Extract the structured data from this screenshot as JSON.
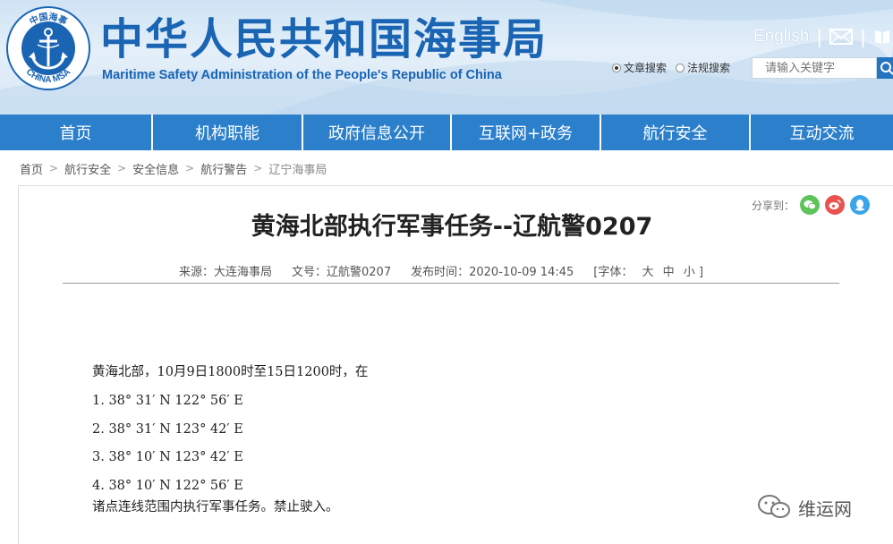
{
  "header": {
    "logo_top_text": "中国海事",
    "logo_bottom_text": "CHINA MSA",
    "title_cn": "中华人民共和国海事局",
    "title_en": "Maritime Safety Administration of the People's Republic of China",
    "english_link": "English",
    "separator": "|",
    "search_options": [
      "文章搜索",
      "法规搜索"
    ],
    "search_placeholder": "请输入关键字"
  },
  "nav": {
    "items": [
      "首页",
      "机构职能",
      "政府信息公开",
      "互联网+政务",
      "航行安全",
      "互动交流"
    ]
  },
  "breadcrumb": {
    "items": [
      "首页",
      "航行安全",
      "安全信息",
      "航行警告",
      "辽宁海事局"
    ],
    "separator": ">"
  },
  "share": {
    "label": "分享到："
  },
  "article": {
    "title": "黄海北部执行军事任务--辽航警0207",
    "source": "来源：大连海事局",
    "doc_no": "文号：辽航警0207",
    "publish_time": "发布时间：2020-10-09 14:45",
    "font_label": "[字体：",
    "font_sizes": [
      "大",
      "中",
      "小"
    ],
    "font_close": "]",
    "intro": "黄海北部，10月9日1800时至15日1200时，在",
    "coords": [
      "1. 38° 31′ N  122° 56′ E",
      "2. 38° 31′ N  123° 42′ E",
      "3. 38° 10′ N  123° 42′ E",
      "4. 38° 10′ N  122° 56′ E"
    ],
    "closing": "诸点连线范围内执行军事任务。禁止驶入。"
  },
  "watermark": {
    "text": "维运网"
  },
  "colors": {
    "brand_blue": "#1a64b4",
    "nav_blue": "#2b7fcb",
    "wechat_green": "#5cc45a",
    "weibo_red": "#e8534f",
    "qq_blue": "#3aa5e8"
  }
}
